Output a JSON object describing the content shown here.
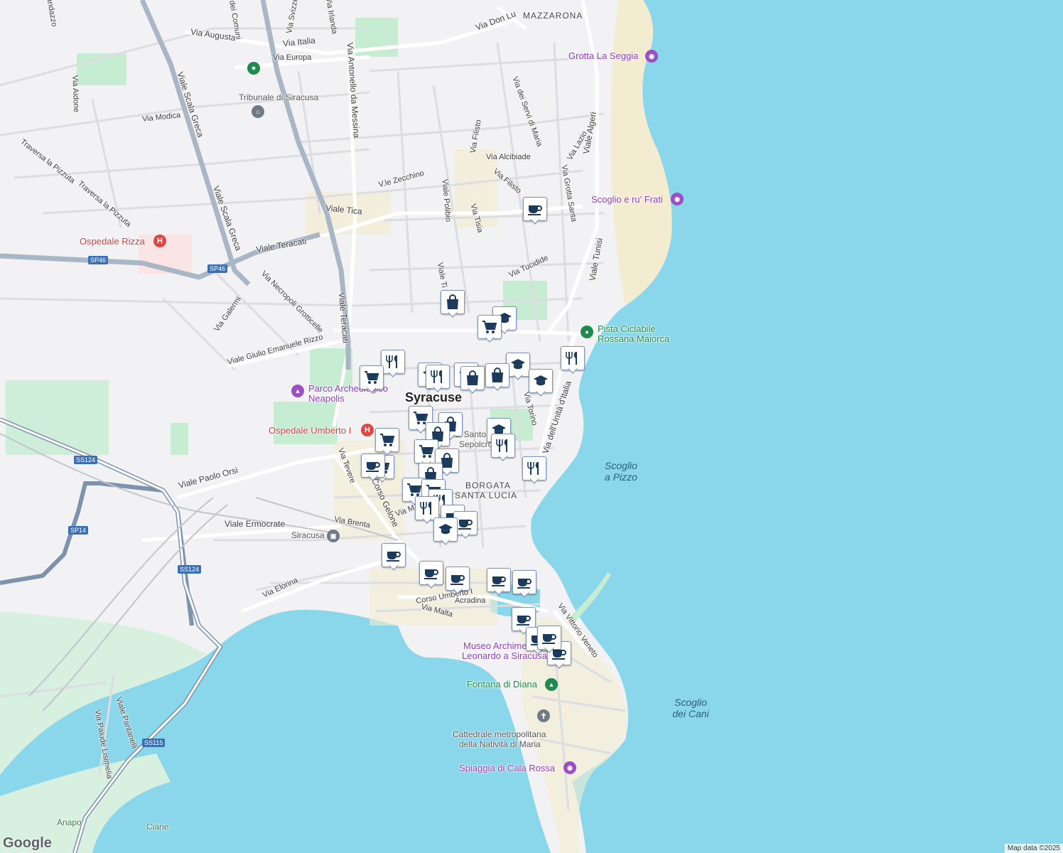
{
  "map": {
    "attribution": "Map data ©2025",
    "logo": "Google",
    "city_label": "Syracuse",
    "districts": [
      {
        "text": "MAZZARONA"
      },
      {
        "text": "BORGATA"
      },
      {
        "text": "SANTA LUCIA"
      }
    ],
    "streets": [
      {
        "text": "Via Augusta"
      },
      {
        "text": "Via Italia"
      },
      {
        "text": "Via Europa"
      },
      {
        "text": "Viale Scala Greca"
      },
      {
        "text": "Via Aidone"
      },
      {
        "text": "Via Modica"
      },
      {
        "text": "Traversa la Pizzuta"
      },
      {
        "text": "Traversa la Pizzuta"
      },
      {
        "text": "Viale Scala Greca"
      },
      {
        "text": "Viale Tica"
      },
      {
        "text": "Viale Teracati"
      },
      {
        "text": "Via Necropoli Grotticelle"
      },
      {
        "text": "Via Galermi"
      },
      {
        "text": "Viale Giulio Emanuele Rizzo"
      },
      {
        "text": "Viale Teracati"
      },
      {
        "text": "Via Antonello da Messina"
      },
      {
        "text": "V.le Zecchino"
      },
      {
        "text": "Viale Polibio"
      },
      {
        "text": "Via Tisia"
      },
      {
        "text": "Via Filisto"
      },
      {
        "text": "Via Filisto"
      },
      {
        "text": "Via Alcibiade"
      },
      {
        "text": "Via dei Servi di Maria"
      },
      {
        "text": "Via Grotta Santa"
      },
      {
        "text": "Via Lazio"
      },
      {
        "text": "Viale Algeri"
      },
      {
        "text": "Viale Tunisi"
      },
      {
        "text": "Via Tucidide"
      },
      {
        "text": "Viale Ti"
      },
      {
        "text": "Via Torino"
      },
      {
        "text": "Via dell'Unità d'Italia"
      },
      {
        "text": "Viale Paolo Orsi"
      },
      {
        "text": "Via Tevere"
      },
      {
        "text": "Corso Gelone"
      },
      {
        "text": "Via Brenta"
      },
      {
        "text": "Viale Ermocrate"
      },
      {
        "text": "Via Elorina"
      },
      {
        "text": "Corso Umberto I"
      },
      {
        "text": "Via Malta"
      },
      {
        "text": "Via Vittorio Veneto"
      },
      {
        "text": "Viale Pantanelli"
      },
      {
        "text": "Via Palude Lisimelia"
      },
      {
        "text": "Via Don Lu"
      },
      {
        "text": "Via Irlanda"
      },
      {
        "text": "Via Svizzera"
      },
      {
        "text": "Via dei Comuni"
      },
      {
        "text": "Via M"
      },
      {
        "text": "Acradina"
      },
      {
        "text": "andazzo"
      }
    ],
    "shields": [
      {
        "text": "SP46"
      },
      {
        "text": "SP46"
      },
      {
        "text": "SS124"
      },
      {
        "text": "SS124"
      },
      {
        "text": "SP14"
      },
      {
        "text": "SS115"
      }
    ],
    "places": [
      {
        "text": "Tribunale di Siracusa",
        "kind": "gray"
      },
      {
        "text": "Grotta La Seggia",
        "kind": "poi"
      },
      {
        "text": "Scoglio e ru' Frati",
        "kind": "poi"
      },
      {
        "text": "Ospedale Rizza",
        "kind": "hosp"
      },
      {
        "text": "Pista Ciclabile",
        "kind": "green"
      },
      {
        "text": "Rossana Maiorca",
        "kind": "green"
      },
      {
        "text": "Parco Archeologico",
        "kind": "poi"
      },
      {
        "text": "Neapolis",
        "kind": "poi"
      },
      {
        "text": "Ospedale Umberto I",
        "kind": "hosp"
      },
      {
        "text": "Siracusa",
        "kind": "gray"
      },
      {
        "text": "Museo Archimede e",
        "kind": "poi"
      },
      {
        "text": "Leonardo a Siracusa",
        "kind": "poi"
      },
      {
        "text": "Fontana di Diana",
        "kind": "green"
      },
      {
        "text": "Cattedrale metropolitana",
        "kind": "gray"
      },
      {
        "text": "della Natività di Maria",
        "kind": "gray"
      },
      {
        "text": "Spiaggia di Cala Rossa",
        "kind": "poi"
      },
      {
        "text": "di Santo",
        "kind": "gray"
      },
      {
        "text": "Sepolcro",
        "kind": "gray"
      },
      {
        "text": "Anapo",
        "kind": "park"
      },
      {
        "text": "Ciane",
        "kind": "park"
      }
    ],
    "water_labels": [
      {
        "text": "Scoglio a Pizzo"
      },
      {
        "text": "Scoglio dei Cani"
      }
    ],
    "colors": {
      "water": "#8ad6ea",
      "land": "#f2f2f4",
      "park": "#c6ecd2",
      "beach": "#f4ecd0",
      "major_road": "#8fa3b8",
      "pin_icon": "#1b3a5c"
    },
    "markers": [
      {
        "icon": "cafe"
      },
      {
        "icon": "shopping-bag"
      },
      {
        "icon": "school"
      },
      {
        "icon": "grocery-cart"
      },
      {
        "icon": "restaurant"
      },
      {
        "icon": "school"
      },
      {
        "icon": "restaurant"
      },
      {
        "icon": "grocery-cart"
      },
      {
        "icon": "school"
      },
      {
        "icon": "restaurant"
      },
      {
        "icon": "school"
      },
      {
        "icon": "shopping-bag"
      },
      {
        "icon": "shopping-bag"
      },
      {
        "icon": "school"
      },
      {
        "icon": "grocery-cart"
      },
      {
        "icon": "shopping-bag"
      },
      {
        "icon": "shopping-bag"
      },
      {
        "icon": "grocery-cart"
      },
      {
        "icon": "school"
      },
      {
        "icon": "restaurant"
      },
      {
        "icon": "grocery-cart"
      },
      {
        "icon": "shopping-bag"
      },
      {
        "icon": "restaurant"
      },
      {
        "icon": "grocery-cart"
      },
      {
        "icon": "cafe"
      },
      {
        "icon": "shopping-bag"
      },
      {
        "icon": "grocery-cart"
      },
      {
        "icon": "grocery-cart"
      },
      {
        "icon": "restaurant"
      },
      {
        "icon": "restaurant"
      },
      {
        "icon": "cafe"
      },
      {
        "icon": "cafe"
      },
      {
        "icon": "school"
      },
      {
        "icon": "cafe"
      },
      {
        "icon": "cafe"
      },
      {
        "icon": "cafe"
      },
      {
        "icon": "cafe"
      },
      {
        "icon": "cafe"
      },
      {
        "icon": "cafe"
      },
      {
        "icon": "cafe"
      },
      {
        "icon": "cafe"
      },
      {
        "icon": "cafe"
      }
    ]
  }
}
